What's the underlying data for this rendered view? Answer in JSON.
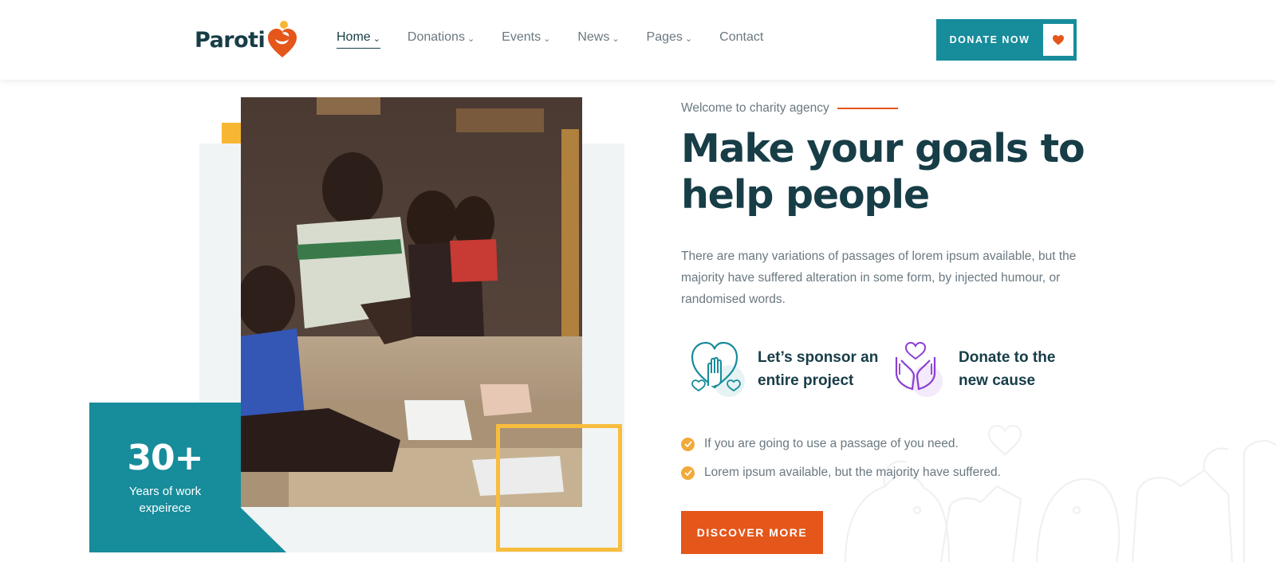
{
  "brand": {
    "name": "Paroti"
  },
  "nav": {
    "items": [
      {
        "label": "Home",
        "dropdown": true,
        "active": true
      },
      {
        "label": "Donations",
        "dropdown": true
      },
      {
        "label": "Events",
        "dropdown": true
      },
      {
        "label": "News",
        "dropdown": true
      },
      {
        "label": "Pages",
        "dropdown": true
      },
      {
        "label": "Contact",
        "dropdown": false
      }
    ],
    "donate_label": "DONATE NOW"
  },
  "experience": {
    "number": "30+",
    "line1": "Years of work",
    "line2": "expeirece"
  },
  "hero": {
    "tagline": "Welcome to charity agency",
    "headline_line1": "Make your goals to",
    "headline_line2": "help people",
    "paragraph": "There are many variations of passages of lorem ipsum available, but the majority have suffered alteration in some form, by injected humour, or randomised words."
  },
  "features": [
    {
      "line1": "Let’s sponsor an",
      "line2": "entire project",
      "icon": "heart-hand-icon"
    },
    {
      "line1": "Donate to the",
      "line2": "new cause",
      "icon": "hands-heart-icon"
    }
  ],
  "checklist": [
    "If you are going to use a passage of you need.",
    "Lorem ipsum available, but the majority have suffered."
  ],
  "cta": {
    "label": "DISCOVER MORE"
  },
  "colors": {
    "teal": "#178c9b",
    "dark": "#173d47",
    "orange": "#e4561a",
    "yellow": "#f9bd3e",
    "muted": "#6a7880",
    "purple": "#8a3fd1"
  }
}
